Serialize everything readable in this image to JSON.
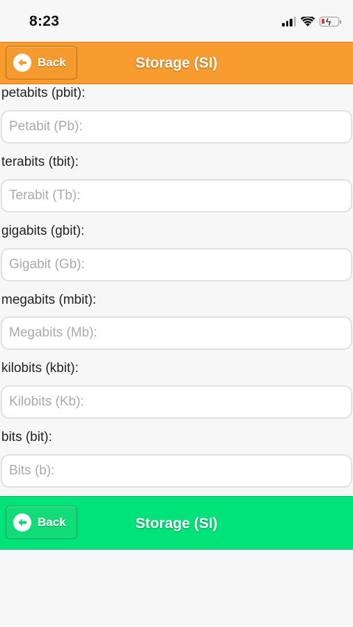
{
  "status_bar": {
    "time": "8:23"
  },
  "header": {
    "back_label": "Back",
    "title": "Storage (SI)",
    "color": "#f89c2f"
  },
  "fields": [
    {
      "label": "petabits (pbit):",
      "placeholder": "Petabit (Pb):",
      "value": ""
    },
    {
      "label": "terabits (tbit):",
      "placeholder": "Terabit (Tb):",
      "value": ""
    },
    {
      "label": "gigabits (gbit):",
      "placeholder": "Gigabit (Gb):",
      "value": ""
    },
    {
      "label": "megabits (mbit):",
      "placeholder": "Megabits (Mb):",
      "value": ""
    },
    {
      "label": "kilobits (kbit):",
      "placeholder": "Kilobits (Kb):",
      "value": ""
    },
    {
      "label": "bits (bit):",
      "placeholder": "Bits (b):",
      "value": ""
    }
  ],
  "footer": {
    "back_label": "Back",
    "title": "Storage (SI)",
    "color": "#00e27a"
  }
}
